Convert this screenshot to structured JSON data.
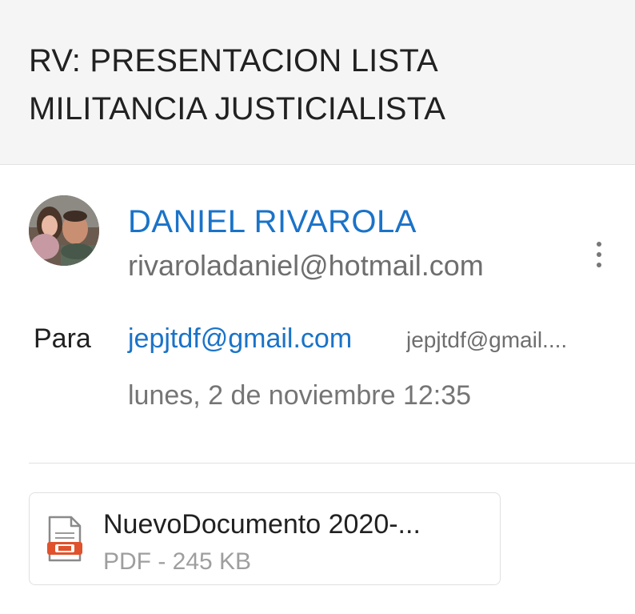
{
  "email": {
    "subject": "RV: PRESENTACION LISTA MILITANCIA JUSTICIALISTA",
    "sender": {
      "name": "DANIEL RIVAROLA",
      "email": "rivaroladaniel@hotmail.com"
    },
    "recipient": {
      "label": "Para",
      "email": "jepjtdf@gmail.com",
      "name": "jepjtdf@gmail...."
    },
    "date": "lunes, 2 de noviembre 12:35",
    "attachment": {
      "name": "NuevoDocumento 2020-...",
      "meta": "PDF - 245 KB",
      "icon": "pdf-file-icon"
    }
  },
  "icons": {
    "more": "more-vert-icon",
    "avatar": "avatar-photo"
  },
  "colors": {
    "link_blue": "#1a73c8",
    "subject_bg": "#f5f5f5",
    "pdf_red": "#e0522b"
  }
}
